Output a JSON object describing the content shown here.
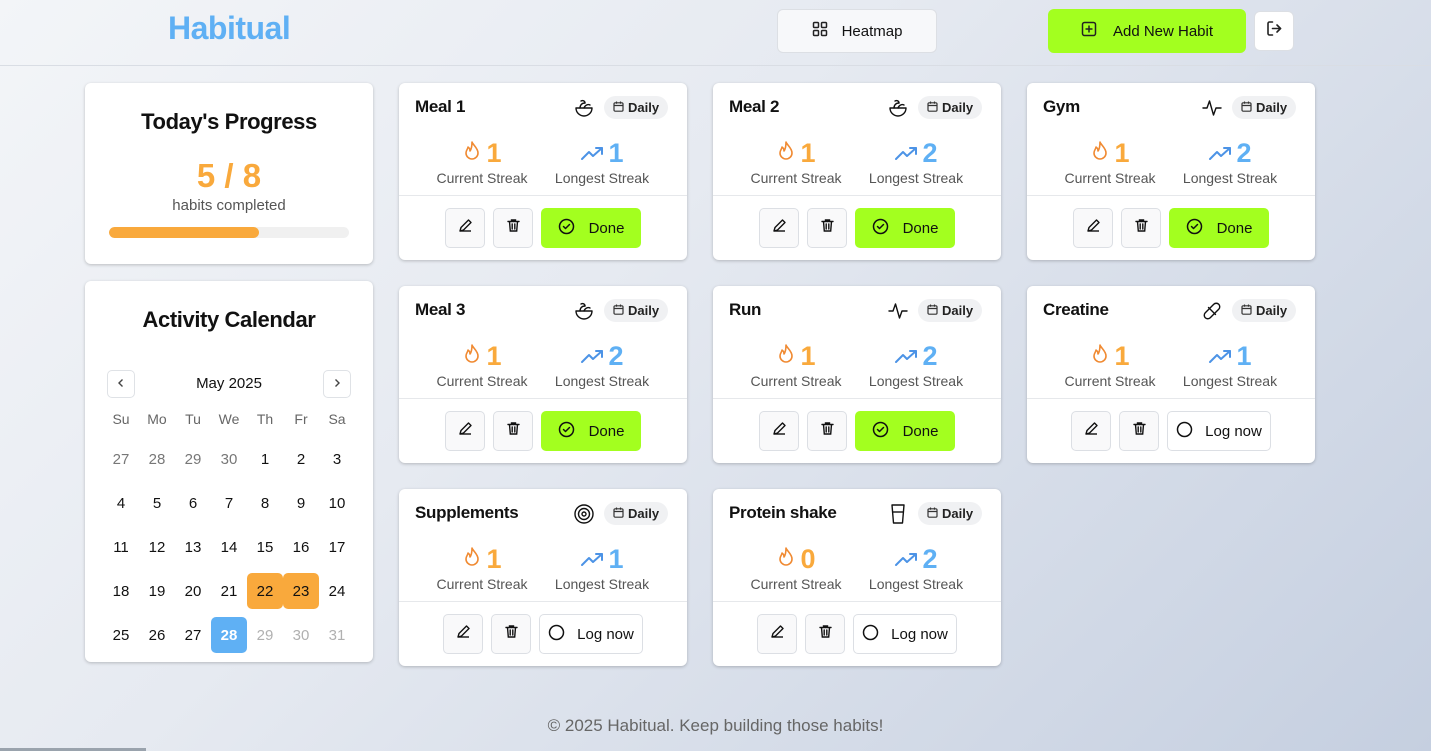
{
  "app": {
    "logo": "Habitual"
  },
  "header": {
    "heatmap_label": "Heatmap",
    "add_label": "Add New Habit"
  },
  "progress": {
    "title": "Today's Progress",
    "count": "5 / 8",
    "subtitle": "habits completed",
    "completed": 5,
    "total": 8,
    "fraction": 0.625
  },
  "calendar": {
    "title": "Activity Calendar",
    "month": "May 2025",
    "weekdays": [
      "Su",
      "Mo",
      "Tu",
      "We",
      "Th",
      "Fr",
      "Sa"
    ],
    "weeks": [
      [
        {
          "d": "27",
          "s": "other"
        },
        {
          "d": "28",
          "s": "other"
        },
        {
          "d": "29",
          "s": "other"
        },
        {
          "d": "30",
          "s": "other"
        },
        {
          "d": "1",
          "s": ""
        },
        {
          "d": "2",
          "s": ""
        },
        {
          "d": "3",
          "s": ""
        }
      ],
      [
        {
          "d": "4",
          "s": ""
        },
        {
          "d": "5",
          "s": ""
        },
        {
          "d": "6",
          "s": ""
        },
        {
          "d": "7",
          "s": ""
        },
        {
          "d": "8",
          "s": ""
        },
        {
          "d": "9",
          "s": ""
        },
        {
          "d": "10",
          "s": ""
        }
      ],
      [
        {
          "d": "11",
          "s": ""
        },
        {
          "d": "12",
          "s": ""
        },
        {
          "d": "13",
          "s": ""
        },
        {
          "d": "14",
          "s": ""
        },
        {
          "d": "15",
          "s": ""
        },
        {
          "d": "16",
          "s": ""
        },
        {
          "d": "17",
          "s": ""
        }
      ],
      [
        {
          "d": "18",
          "s": ""
        },
        {
          "d": "19",
          "s": ""
        },
        {
          "d": "20",
          "s": ""
        },
        {
          "d": "21",
          "s": ""
        },
        {
          "d": "22",
          "s": "done"
        },
        {
          "d": "23",
          "s": "done"
        },
        {
          "d": "24",
          "s": ""
        }
      ],
      [
        {
          "d": "25",
          "s": ""
        },
        {
          "d": "26",
          "s": ""
        },
        {
          "d": "27",
          "s": ""
        },
        {
          "d": "28",
          "s": "today"
        },
        {
          "d": "29",
          "s": "future"
        },
        {
          "d": "30",
          "s": "future"
        },
        {
          "d": "31",
          "s": "future"
        }
      ]
    ]
  },
  "labels": {
    "current": "Current Streak",
    "longest": "Longest Streak",
    "done": "Done",
    "log": "Log now",
    "frequency": "Daily"
  },
  "habits": [
    {
      "name": "Meal 1",
      "icon": "salad-icon",
      "frequency": "Daily",
      "current": "1",
      "longest": "1",
      "done": true
    },
    {
      "name": "Meal 2",
      "icon": "salad-icon",
      "frequency": "Daily",
      "current": "1",
      "longest": "2",
      "done": true
    },
    {
      "name": "Gym",
      "icon": "activity-icon",
      "frequency": "Daily",
      "current": "1",
      "longest": "2",
      "done": true
    },
    {
      "name": "Meal 3",
      "icon": "salad-icon",
      "frequency": "Daily",
      "current": "1",
      "longest": "2",
      "done": true
    },
    {
      "name": "Run",
      "icon": "activity-icon",
      "frequency": "Daily",
      "current": "1",
      "longest": "2",
      "done": true
    },
    {
      "name": "Creatine",
      "icon": "pill-icon",
      "frequency": "Daily",
      "current": "1",
      "longest": "1",
      "done": false
    },
    {
      "name": "Supplements",
      "icon": "target-icon",
      "frequency": "Daily",
      "current": "1",
      "longest": "1",
      "done": false
    },
    {
      "name": "Protein shake",
      "icon": "cup-icon",
      "frequency": "Daily",
      "current": "0",
      "longest": "2",
      "done": false
    }
  ],
  "footer": {
    "text": "© 2025 Habitual. Keep building those habits!"
  },
  "colors": {
    "accent_green": "#a3ff1f",
    "streak_orange": "#f9a93c",
    "streak_blue": "#5fb0f4"
  }
}
